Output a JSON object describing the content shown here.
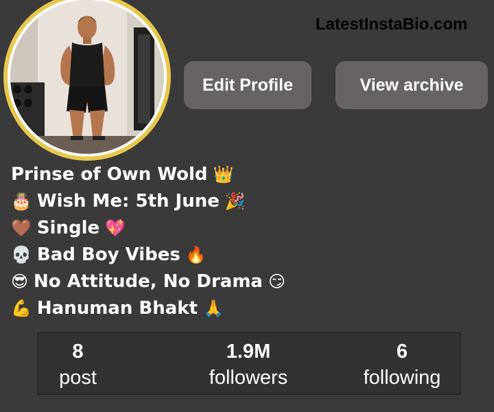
{
  "site": {
    "title": "LatestInstaBio.com"
  },
  "profile": {
    "avatar_icon": "profile-photo-fitness-man"
  },
  "buttons": {
    "edit_profile": "Edit Profile",
    "view_archive": "View archive"
  },
  "bio": [
    {
      "lead_icon": "",
      "text": "Prinse of Own Wold",
      "trail_icon": "👑"
    },
    {
      "lead_icon": "🎂",
      "text": "Wish Me: 5th June",
      "trail_icon": "🎉"
    },
    {
      "lead_icon": "🤎",
      "text": "Single",
      "trail_icon": "💖"
    },
    {
      "lead_icon": "💀",
      "text": "Bad Boy Vibes",
      "trail_icon": "🔥"
    },
    {
      "lead_icon": "😎",
      "text": "No Attitude, No Drama",
      "trail_icon": "😏"
    },
    {
      "lead_icon": "💪",
      "text": "Hanuman Bhakt",
      "trail_icon": "🙏"
    }
  ],
  "stats": {
    "posts": {
      "value": "8",
      "label": "post"
    },
    "followers": {
      "value": "1.9M",
      "label": "followers"
    },
    "following": {
      "value": "6",
      "label": "following"
    }
  },
  "colors": {
    "background": "#3a3a3a",
    "button": "#676362",
    "avatar_ring": "#e7c84d",
    "stats_box": "#333232"
  }
}
